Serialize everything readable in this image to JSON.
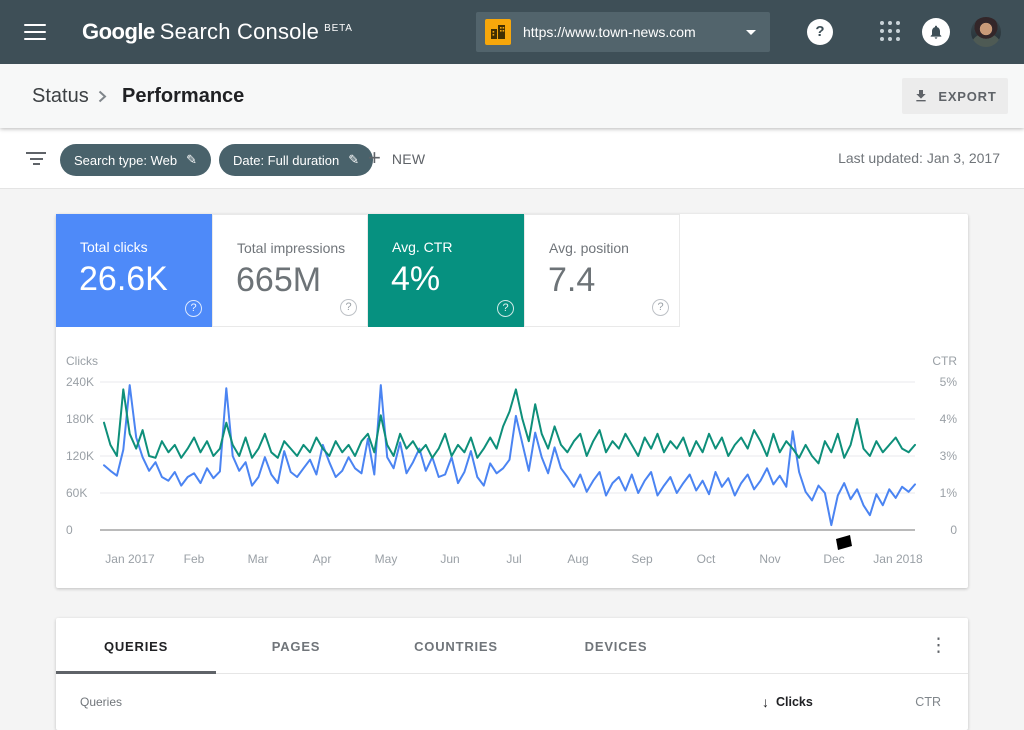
{
  "header": {
    "google": "Google",
    "product": "Search Console",
    "beta": "BETA",
    "property_url": "https://www.town-news.com"
  },
  "breadcrumb": {
    "status": "Status",
    "performance": "Performance"
  },
  "export_label": "EXPORT",
  "filters": {
    "chip_search_type": "Search type: Web",
    "chip_date": "Date: Full duration",
    "new_label": "NEW",
    "last_updated": "Last updated: Jan 3, 2017"
  },
  "metrics": {
    "cards": [
      {
        "label": "Total clicks",
        "value": "26.6K",
        "selected": true,
        "color": "#4e8af9"
      },
      {
        "label": "Total impressions",
        "value": "665M",
        "selected": false,
        "color": "#ffffff"
      },
      {
        "label": "Avg. CTR",
        "value": "4%",
        "selected": true,
        "color": "#069180"
      },
      {
        "label": "Avg. position",
        "value": "7.4",
        "selected": false,
        "color": "#ffffff"
      }
    ]
  },
  "chart_data": {
    "type": "line",
    "title": "Clicks and CTR over time",
    "x_labels": [
      "Jan 2017",
      "Feb",
      "Mar",
      "Apr",
      "May",
      "Jun",
      "Jul",
      "Aug",
      "Sep",
      "Oct",
      "Nov",
      "Dec",
      "Jan 2018"
    ],
    "y_left": {
      "title": "Clicks",
      "tick_labels": [
        "240K",
        "180K",
        "120K",
        "60K",
        "0"
      ],
      "tick_values_thousands": [
        240,
        180,
        120,
        60,
        0
      ]
    },
    "y_right": {
      "title": "CTR",
      "tick_labels": [
        "5%",
        "4%",
        "3%",
        "1%",
        "0"
      ],
      "tick_values_percent": [
        5,
        4,
        3,
        1,
        0
      ]
    },
    "grid": true,
    "legend": "none",
    "series": [
      {
        "name": "Clicks",
        "axis": "left",
        "unit": "thousands",
        "color": "#4b84f2",
        "values": [
          105,
          96,
          88,
          130,
          235,
          150,
          118,
          96,
          110,
          86,
          80,
          94,
          72,
          86,
          92,
          76,
          100,
          84,
          95,
          230,
          120,
          96,
          110,
          72,
          86,
          118,
          90,
          76,
          128,
          94,
          86,
          100,
          114,
          90,
          138,
          110,
          86,
          96,
          118,
          100,
          92,
          148,
          90,
          235,
          118,
          100,
          142,
          92,
          110,
          132,
          96,
          118,
          86,
          90,
          118,
          76,
          94,
          128,
          86,
          72,
          108,
          92,
          100,
          114,
          185,
          140,
          96,
          158,
          118,
          92,
          134,
          100,
          86,
          70,
          90,
          62,
          80,
          94,
          56,
          76,
          86,
          64,
          90,
          60,
          80,
          94,
          56,
          72,
          86,
          60,
          76,
          90,
          64,
          80,
          58,
          94,
          70,
          84,
          56,
          76,
          90,
          66,
          80,
          100,
          74,
          88,
          70,
          160,
          94,
          62,
          48,
          72,
          60,
          8,
          56,
          76,
          50,
          66,
          40,
          24,
          58,
          40,
          66,
          52,
          70,
          62,
          74
        ]
      },
      {
        "name": "CTR",
        "axis": "right",
        "unit": "percent",
        "color": "#0e8f7a",
        "values": [
          3.9,
          3.3,
          3.0,
          4.8,
          3.6,
          3.2,
          3.7,
          3.0,
          2.9,
          3.4,
          3.1,
          3.3,
          2.9,
          3.2,
          3.5,
          3.1,
          3.4,
          3.0,
          3.2,
          3.9,
          3.3,
          3.0,
          3.5,
          2.9,
          3.2,
          3.6,
          3.1,
          2.9,
          3.4,
          3.2,
          3.0,
          3.3,
          3.1,
          3.5,
          3.2,
          3.0,
          3.4,
          3.1,
          3.3,
          3.0,
          3.4,
          3.6,
          3.1,
          4.1,
          3.3,
          3.0,
          3.6,
          3.2,
          3.4,
          3.1,
          3.3,
          2.9,
          3.2,
          3.6,
          3.0,
          3.3,
          3.1,
          3.5,
          2.9,
          3.2,
          3.5,
          3.2,
          3.8,
          4.2,
          4.8,
          4.0,
          3.4,
          4.4,
          3.6,
          3.2,
          3.8,
          3.3,
          3.1,
          3.4,
          3.6,
          3.0,
          3.4,
          3.7,
          3.1,
          3.4,
          3.2,
          3.6,
          3.3,
          3.0,
          3.5,
          3.2,
          3.6,
          3.1,
          3.4,
          3.2,
          3.5,
          3.0,
          3.4,
          3.1,
          3.6,
          3.2,
          3.5,
          3.0,
          3.3,
          3.5,
          3.2,
          3.7,
          3.4,
          3.0,
          3.6,
          3.1,
          3.4,
          3.2,
          2.9,
          3.3,
          3.0,
          2.6,
          3.4,
          3.1,
          3.6,
          2.9,
          3.3,
          4.0,
          3.2,
          3.0,
          3.4,
          3.1,
          3.3,
          3.5,
          3.2,
          3.1,
          3.3
        ]
      }
    ]
  },
  "tabs": {
    "items": [
      "QUERIES",
      "PAGES",
      "COUNTRIES",
      "DEVICES"
    ],
    "active": "QUERIES"
  },
  "table": {
    "col_queries": "Queries",
    "col_clicks": "Clicks",
    "col_ctr": "CTR",
    "sorted_by": "Clicks"
  },
  "icons": {
    "pencil": "✎",
    "plus": "+",
    "sort_down": "↓",
    "kebab": "⋮",
    "question": "?"
  },
  "colors": {
    "header_bg": "#3e4f57",
    "chip_bg": "#49626b",
    "accent_blue": "#4e8af9",
    "accent_teal": "#069180",
    "line_blue": "#4b84f2",
    "line_green": "#0e8f7a",
    "content_bg": "#f4f4f4"
  }
}
